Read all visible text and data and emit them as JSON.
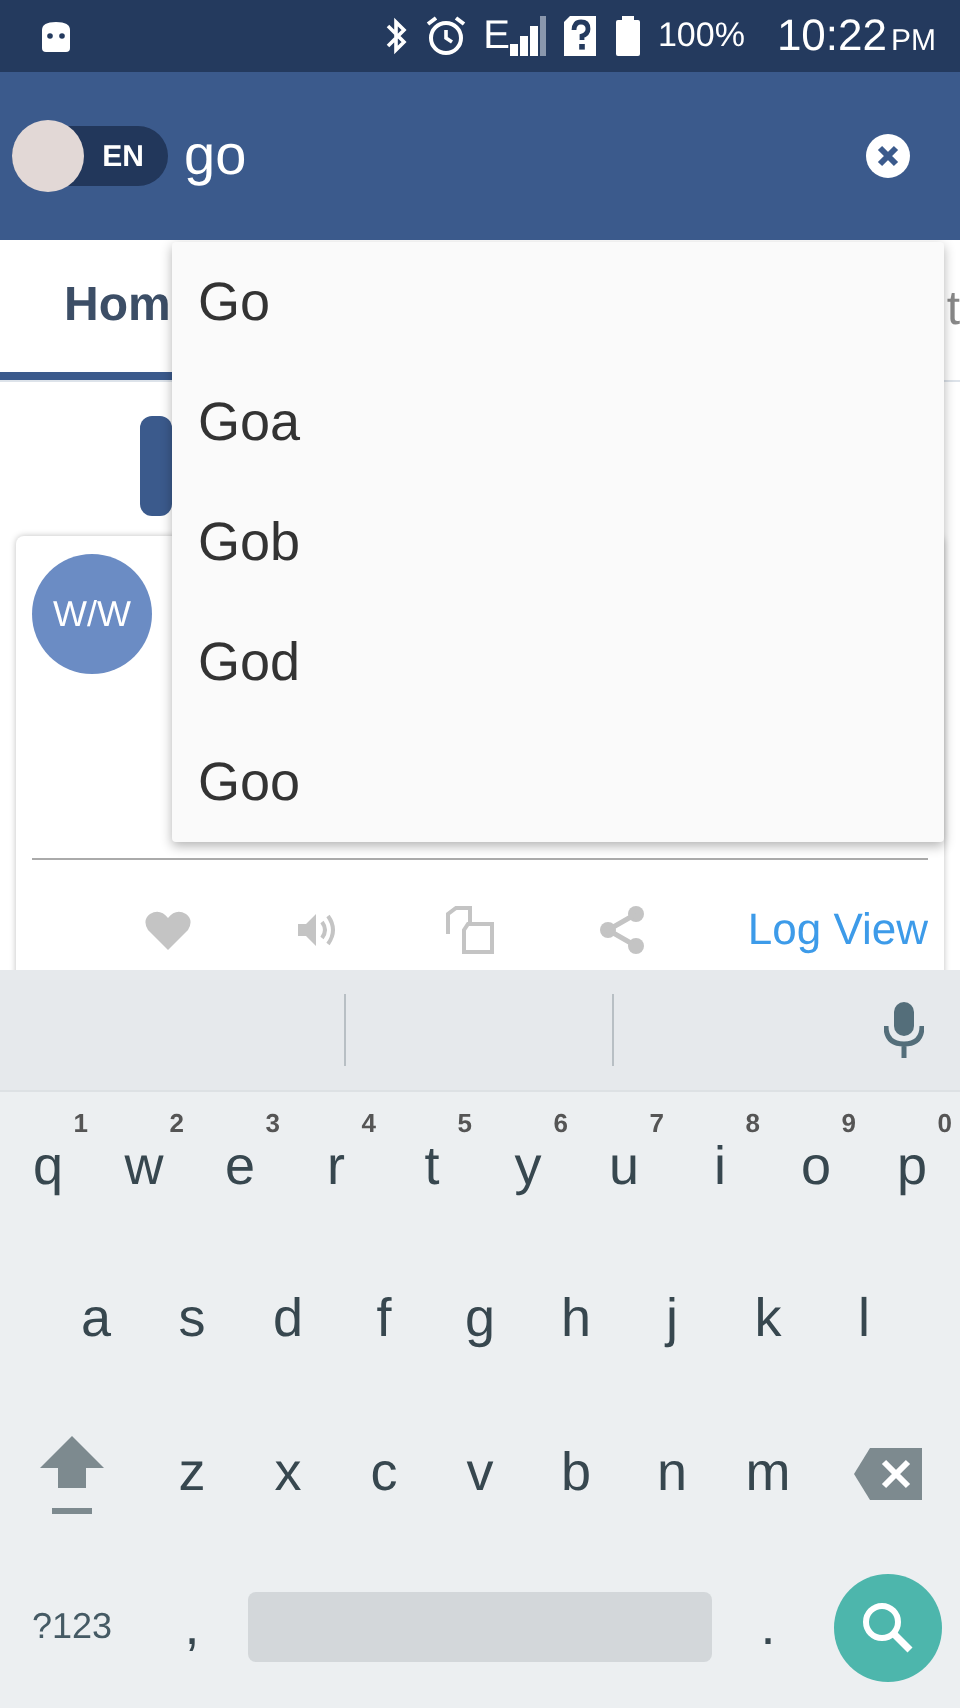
{
  "status_bar": {
    "network": "E",
    "battery": "100%",
    "time": "10:22",
    "period": "PM"
  },
  "search_bar": {
    "language_toggle": {
      "label": "EN",
      "on": false
    },
    "value": "go"
  },
  "tabs": [
    {
      "label": "Hom",
      "selected": true
    },
    {
      "label": "t",
      "selected": false
    }
  ],
  "card": {
    "avatar": "W/W",
    "link": "Log View"
  },
  "suggestions": [
    "Go",
    "Goa",
    "Gob",
    "God",
    "Goo"
  ],
  "keyboard": {
    "rows": [
      {
        "keys": [
          {
            "kind": "char",
            "label": "q",
            "hint": "1"
          },
          {
            "kind": "char",
            "label": "w",
            "hint": "2"
          },
          {
            "kind": "char",
            "label": "e",
            "hint": "3"
          },
          {
            "kind": "char",
            "label": "r",
            "hint": "4"
          },
          {
            "kind": "char",
            "label": "t",
            "hint": "5"
          },
          {
            "kind": "char",
            "label": "y",
            "hint": "6"
          },
          {
            "kind": "char",
            "label": "u",
            "hint": "7"
          },
          {
            "kind": "char",
            "label": "i",
            "hint": "8"
          },
          {
            "kind": "char",
            "label": "o",
            "hint": "9"
          },
          {
            "kind": "char",
            "label": "p",
            "hint": "0"
          }
        ]
      },
      {
        "keys": [
          {
            "kind": "char",
            "label": "a"
          },
          {
            "kind": "char",
            "label": "s"
          },
          {
            "kind": "char",
            "label": "d"
          },
          {
            "kind": "char",
            "label": "f"
          },
          {
            "kind": "char",
            "label": "g"
          },
          {
            "kind": "char",
            "label": "h"
          },
          {
            "kind": "char",
            "label": "j"
          },
          {
            "kind": "char",
            "label": "k"
          },
          {
            "kind": "char",
            "label": "l"
          }
        ]
      },
      {
        "keys": [
          {
            "kind": "shift"
          },
          {
            "kind": "char",
            "label": "z"
          },
          {
            "kind": "char",
            "label": "x"
          },
          {
            "kind": "char",
            "label": "c"
          },
          {
            "kind": "char",
            "label": "v"
          },
          {
            "kind": "char",
            "label": "b"
          },
          {
            "kind": "char",
            "label": "n"
          },
          {
            "kind": "char",
            "label": "m"
          },
          {
            "kind": "backspace"
          }
        ]
      },
      {
        "keys": [
          {
            "kind": "symbols",
            "label": "?123"
          },
          {
            "kind": "char",
            "label": ","
          },
          {
            "kind": "space"
          },
          {
            "kind": "char",
            "label": "."
          },
          {
            "kind": "search"
          }
        ]
      }
    ]
  }
}
